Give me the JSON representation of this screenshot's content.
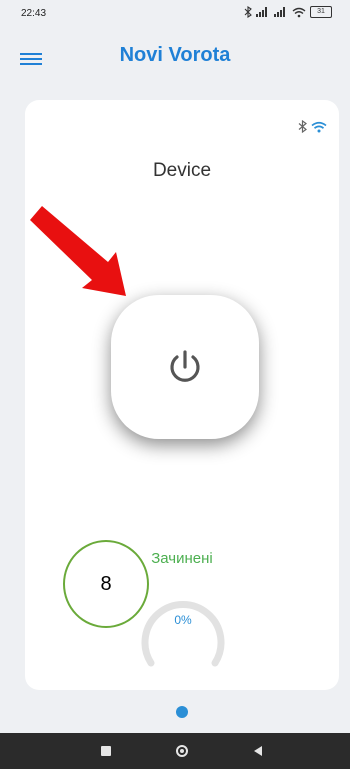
{
  "status_bar": {
    "time": "22:43",
    "battery": "31"
  },
  "app_bar": {
    "title": "Novi Vorota"
  },
  "card": {
    "device_name": "Device",
    "status_text": "Зачинені",
    "progress_text": "0%",
    "progress_fraction": 0
  },
  "annotation": {
    "label": "8"
  },
  "colors": {
    "accent": "#1f80d6",
    "status_green": "#4caf50",
    "arrow_red": "#e81010"
  }
}
